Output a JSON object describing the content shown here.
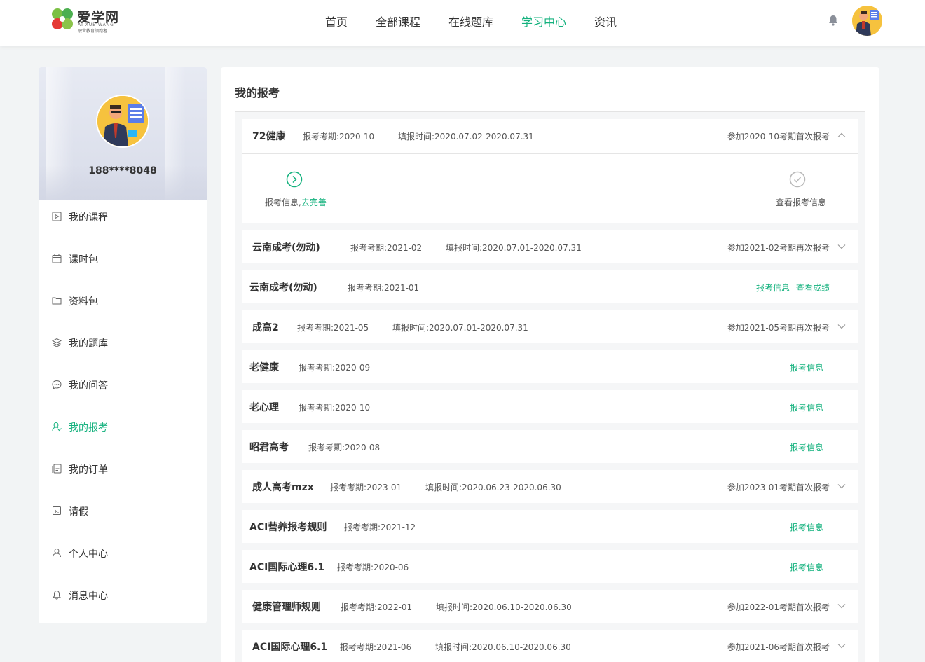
{
  "colors": {
    "accent": "#13b17d",
    "page_bg": "#f2f4f5",
    "text": "#333333"
  },
  "header": {
    "logo": {
      "text": "爱学网",
      "sub_en": "AI XUE WANG",
      "sub_cn": "职业教育领跑者"
    },
    "nav": [
      {
        "label": "首页",
        "active": false
      },
      {
        "label": "全部课程",
        "active": false
      },
      {
        "label": "在线题库",
        "active": false
      },
      {
        "label": "学习中心",
        "active": true
      },
      {
        "label": "资讯",
        "active": false
      }
    ],
    "icons": {
      "bell": "bell-icon",
      "avatar": "user-avatar"
    }
  },
  "sidebar": {
    "phone": "188****8048",
    "menu": [
      {
        "label": "我的课程",
        "icon": "video-icon",
        "active": false
      },
      {
        "label": "课时包",
        "icon": "calendar-icon",
        "active": false
      },
      {
        "label": "资料包",
        "icon": "folder-icon",
        "active": false
      },
      {
        "label": "我的题库",
        "icon": "layers-icon",
        "active": false
      },
      {
        "label": "我的问答",
        "icon": "chat-icon",
        "active": false
      },
      {
        "label": "我的报考",
        "icon": "user-check-icon",
        "active": true
      },
      {
        "label": "我的订单",
        "icon": "order-icon",
        "active": false
      },
      {
        "label": "请假",
        "icon": "leave-icon",
        "active": false
      },
      {
        "label": "个人中心",
        "icon": "person-icon",
        "active": false
      },
      {
        "label": "消息中心",
        "icon": "bell-icon",
        "active": false
      }
    ]
  },
  "main": {
    "title": "我的报考",
    "expanded": {
      "step1_label": "报考信息,",
      "step1_link": "去完善",
      "step2_label": "查看报考信息"
    },
    "cards": [
      {
        "name": "72健康",
        "period": "报考考期:2020-10",
        "fill": "填报时间:2020.07.02-2020.07.31",
        "status": "参加2020-10考期首次报考",
        "expanded": true
      },
      {
        "name": "云南成考(勿动)",
        "period": "报考考期:2021-02",
        "fill": "填报时间:2020.07.01-2020.07.31",
        "status": "参加2021-02考期再次报考"
      },
      {
        "name": "云南成考(勿动)",
        "period": "报考考期:2021-01",
        "links": [
          "报考信息",
          "查看成绩"
        ]
      },
      {
        "name": "成高2",
        "period": "报考考期:2021-05",
        "fill": "填报时间:2020.07.01-2020.07.31",
        "status": "参加2021-05考期再次报考"
      },
      {
        "name": "老健康",
        "period": "报考考期:2020-09",
        "links": [
          "报考信息"
        ]
      },
      {
        "name": "老心理",
        "period": "报考考期:2020-10",
        "links": [
          "报考信息"
        ]
      },
      {
        "name": "昭君高考",
        "period": "报考考期:2020-08",
        "links": [
          "报考信息"
        ]
      },
      {
        "name": "成人高考mzx",
        "period": "报考考期:2023-01",
        "fill": "填报时间:2020.06.23-2020.06.30",
        "status": "参加2023-01考期首次报考"
      },
      {
        "name": "ACI营养报考规则",
        "period": "报考考期:2021-12",
        "links": [
          "报考信息"
        ]
      },
      {
        "name": "ACI国际心理6.1",
        "period": "报考考期:2020-06",
        "links": [
          "报考信息"
        ]
      },
      {
        "name": "健康管理师规则",
        "period": "报考考期:2022-01",
        "fill": "填报时间:2020.06.10-2020.06.30",
        "status": "参加2022-01考期首次报考"
      },
      {
        "name": "ACI国际心理6.1",
        "period": "报考考期:2021-06",
        "fill": "填报时间:2020.06.10-2020.06.30",
        "status": "参加2021-06考期首次报考"
      }
    ]
  }
}
